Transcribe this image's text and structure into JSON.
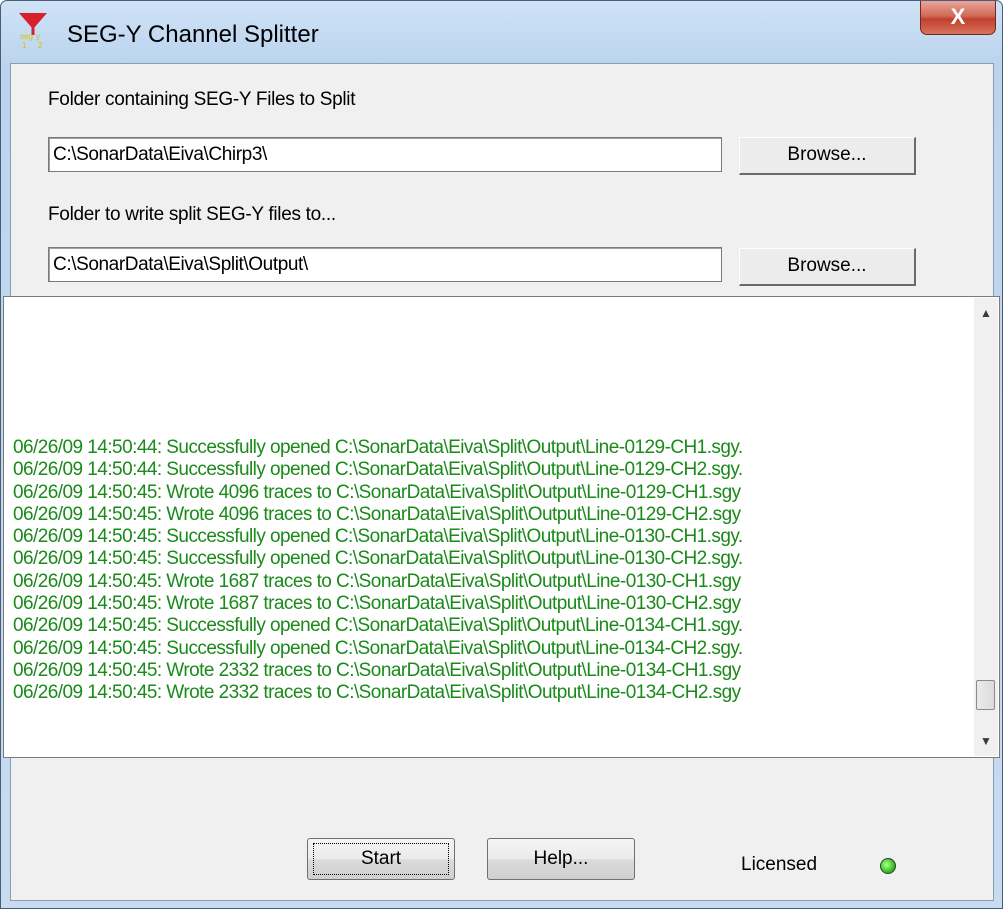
{
  "window": {
    "title": "SEG-Y Channel Splitter",
    "close_glyph": "X",
    "icon": "segy-split-app-icon"
  },
  "source": {
    "label": "Folder containing SEG-Y Files to Split",
    "value": "C:\\SonarData\\Eiva\\Chirp3\\",
    "browse_label": "Browse..."
  },
  "output": {
    "label": "Folder to write split SEG-Y files to...",
    "value": "C:\\SonarData\\Eiva\\Split\\Output\\",
    "browse_label": "Browse..."
  },
  "log": {
    "lines": [
      "06/26/09 14:50:44: Successfully opened C:\\SonarData\\Eiva\\Split\\Output\\Line-0129-CH1.sgy.",
      "06/26/09 14:50:44: Successfully opened C:\\SonarData\\Eiva\\Split\\Output\\Line-0129-CH2.sgy.",
      "06/26/09 14:50:45: Wrote 4096 traces to C:\\SonarData\\Eiva\\Split\\Output\\Line-0129-CH1.sgy",
      "06/26/09 14:50:45: Wrote 4096 traces to C:\\SonarData\\Eiva\\Split\\Output\\Line-0129-CH2.sgy",
      "06/26/09 14:50:45: Successfully opened C:\\SonarData\\Eiva\\Split\\Output\\Line-0130-CH1.sgy.",
      "06/26/09 14:50:45: Successfully opened C:\\SonarData\\Eiva\\Split\\Output\\Line-0130-CH2.sgy.",
      "06/26/09 14:50:45: Wrote 1687 traces to C:\\SonarData\\Eiva\\Split\\Output\\Line-0130-CH1.sgy",
      "06/26/09 14:50:45: Wrote 1687 traces to C:\\SonarData\\Eiva\\Split\\Output\\Line-0130-CH2.sgy",
      "06/26/09 14:50:45: Successfully opened C:\\SonarData\\Eiva\\Split\\Output\\Line-0134-CH1.sgy.",
      "06/26/09 14:50:45: Successfully opened C:\\SonarData\\Eiva\\Split\\Output\\Line-0134-CH2.sgy.",
      "06/26/09 14:50:45: Wrote 2332 traces to C:\\SonarData\\Eiva\\Split\\Output\\Line-0134-CH1.sgy",
      "06/26/09 14:50:45: Wrote 2332 traces to C:\\SonarData\\Eiva\\Split\\Output\\Line-0134-CH2.sgy"
    ],
    "text_color": "#1a8a1a"
  },
  "footer": {
    "start_label": "Start",
    "help_label": "Help...",
    "license_label": "Licensed",
    "license_status_color": "#33cc22"
  }
}
